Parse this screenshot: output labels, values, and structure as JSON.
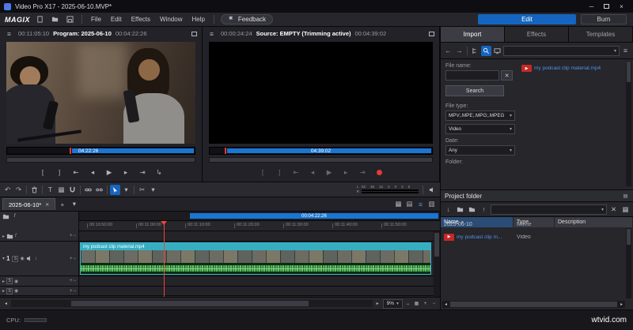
{
  "window": {
    "title": "Video Pro X17 - 2025-06-10.MVP*"
  },
  "menu": {
    "logo": "MAGIX",
    "items": [
      "File",
      "Edit",
      "Effects",
      "Window",
      "Help"
    ],
    "feedback_label": "Feedback",
    "edit_button": "Edit",
    "burn_button": "Burn"
  },
  "program_monitor": {
    "position_timecode": "00:11:05:10",
    "title": "Program: 2025-06-10",
    "duration_timecode": "00:04:22:26",
    "scrubber_label": "04:22:26"
  },
  "source_monitor": {
    "position_timecode": "00:00:24:24",
    "title": "Source: EMPTY (Trimming active)",
    "duration_timecode": "00:04:39:02",
    "scrubber_label": "04:39:02"
  },
  "media_pool": {
    "tabs": [
      "Import",
      "Effects",
      "Templates"
    ],
    "file_name_label": "File name:",
    "file_name_value": "",
    "search_button": "Search",
    "file_type_label": "File type:",
    "file_type_value": "MPV;.MPE;.MPG;.MPEG",
    "media_kind_value": "Video",
    "date_label": "Date:",
    "date_value": "Any",
    "folder_label": "Folder:",
    "files": [
      "my podcast clip material.mp4"
    ]
  },
  "project_folder": {
    "title": "Project folder",
    "columns": [
      "Name",
      "Type",
      "Description"
    ],
    "rows": [
      {
        "name": "2025-06-10",
        "type": "Movie",
        "description": ""
      },
      {
        "name": "my podcast clip m...",
        "type": "Video",
        "description": ""
      }
    ]
  },
  "timeline": {
    "tab_label": "2025-06-10*",
    "range_label": "00:04:22:26",
    "ruler_labels": [
      "00:10:50:00",
      "00:11:00:00",
      "00:11:10:00",
      "00:11:20:00",
      "00:11:30:00",
      "00:11:40:00",
      "00:11:50:00"
    ],
    "clip_label": "my podcast clip material.mp4",
    "track_number": "1",
    "zoom_value": "9%",
    "meter_left": "L",
    "meter_right": "R",
    "meter_scale": [
      "52",
      "36",
      "12",
      "3",
      "0",
      "3",
      "6"
    ]
  },
  "status_bar": {
    "cpu_label": "CPU:",
    "watermark": "wtvid.com"
  }
}
